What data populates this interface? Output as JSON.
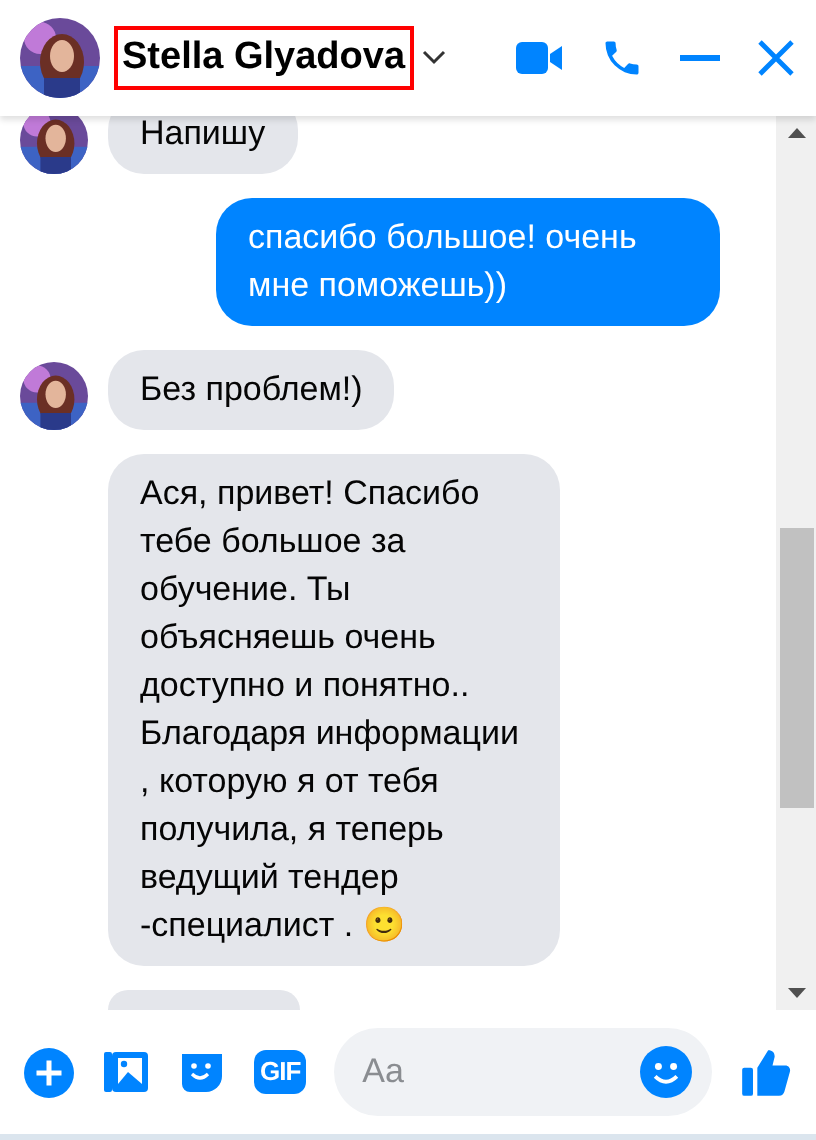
{
  "header": {
    "contact_name": "Stella Glyadova",
    "name_highlighted": true
  },
  "messages": [
    {
      "kind": "incoming",
      "text": "Напишу",
      "avatar": true
    },
    {
      "kind": "outgoing",
      "text": "спасибо большое! очень мне поможешь))",
      "avatar": false
    },
    {
      "kind": "incoming",
      "text": "Без проблем!)",
      "avatar": true
    },
    {
      "kind": "incoming",
      "text": "Ася, привет! Спасибо тебе большое за обучение. Ты объясняешь очень доступно и понятно.. Благодаря информации , которую я от тебя получила, я теперь ведущий тендер -специалист . 🙂",
      "avatar": false
    }
  ],
  "composer": {
    "gif_label": "GIF",
    "placeholder": "Aa"
  }
}
